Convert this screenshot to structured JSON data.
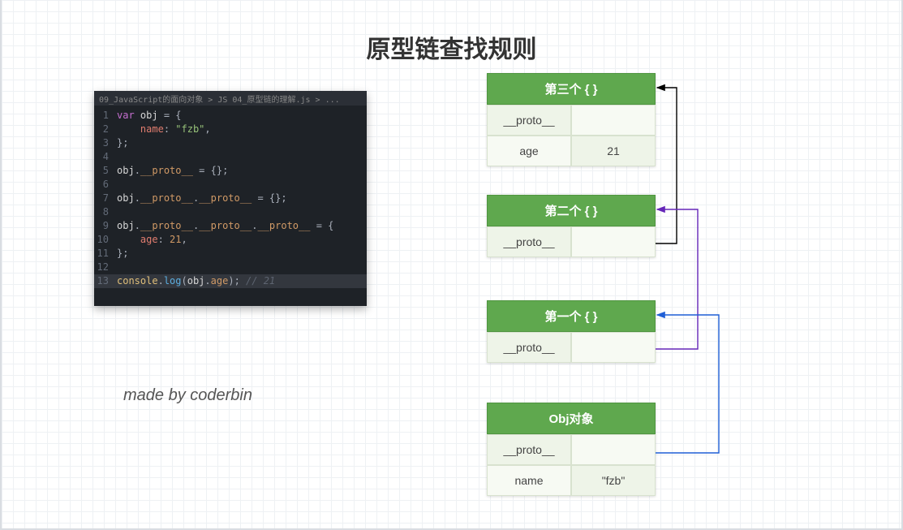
{
  "title": "原型链查找规则",
  "credit": "made by coderbin",
  "editor": {
    "tab": "09_JavaScript的面向对象 > JS  04_原型链的理解.js > ...",
    "lines": [
      {
        "n": 1,
        "segs": [
          [
            "kw",
            "var"
          ],
          [
            "punc",
            " "
          ],
          [
            "ident",
            "obj"
          ],
          [
            "punc",
            " = {"
          ]
        ]
      },
      {
        "n": 2,
        "segs": [
          [
            "punc",
            "    "
          ],
          [
            "prop",
            "name"
          ],
          [
            "punc",
            ": "
          ],
          [
            "str",
            "\"fzb\""
          ],
          [
            "punc",
            ","
          ]
        ]
      },
      {
        "n": 3,
        "segs": [
          [
            "punc",
            "};"
          ]
        ]
      },
      {
        "n": 4,
        "segs": []
      },
      {
        "n": 5,
        "segs": [
          [
            "ident",
            "obj"
          ],
          [
            "punc",
            "."
          ],
          [
            "prop2",
            "__proto__"
          ],
          [
            "punc",
            " = {};"
          ]
        ]
      },
      {
        "n": 6,
        "segs": []
      },
      {
        "n": 7,
        "segs": [
          [
            "ident",
            "obj"
          ],
          [
            "punc",
            "."
          ],
          [
            "prop2",
            "__proto__"
          ],
          [
            "punc",
            "."
          ],
          [
            "prop2",
            "__proto__"
          ],
          [
            "punc",
            " = {};"
          ]
        ]
      },
      {
        "n": 8,
        "segs": []
      },
      {
        "n": 9,
        "segs": [
          [
            "ident",
            "obj"
          ],
          [
            "punc",
            "."
          ],
          [
            "prop2",
            "__proto__"
          ],
          [
            "punc",
            "."
          ],
          [
            "prop2",
            "__proto__"
          ],
          [
            "punc",
            "."
          ],
          [
            "prop2",
            "__proto__"
          ],
          [
            "punc",
            " = {"
          ]
        ]
      },
      {
        "n": 10,
        "segs": [
          [
            "punc",
            "    "
          ],
          [
            "prop",
            "age"
          ],
          [
            "punc",
            ": "
          ],
          [
            "num",
            "21"
          ],
          [
            "punc",
            ","
          ]
        ]
      },
      {
        "n": 11,
        "segs": [
          [
            "punc",
            "};"
          ]
        ]
      },
      {
        "n": 12,
        "segs": []
      },
      {
        "n": 13,
        "hl": true,
        "segs": [
          [
            "obj",
            "console"
          ],
          [
            "punc",
            "."
          ],
          [
            "fn",
            "log"
          ],
          [
            "punc",
            "("
          ],
          [
            "ident",
            "obj"
          ],
          [
            "punc",
            "."
          ],
          [
            "prop2",
            "age"
          ],
          [
            "punc",
            ");"
          ],
          [
            "cmt",
            " // 21"
          ]
        ]
      }
    ]
  },
  "boxes": {
    "b3": {
      "title": "第三个 { }",
      "rows": [
        {
          "k": "__proto__",
          "v": ""
        },
        {
          "k": "age",
          "v": "21"
        }
      ]
    },
    "b2": {
      "title": "第二个 { }",
      "rows": [
        {
          "k": "__proto__",
          "v": ""
        }
      ]
    },
    "b1": {
      "title": "第一个 { }",
      "rows": [
        {
          "k": "__proto__",
          "v": ""
        }
      ]
    },
    "bObj": {
      "title": "Obj对象",
      "rows": [
        {
          "k": "__proto__",
          "v": ""
        },
        {
          "k": "name",
          "v": "\"fzb\""
        }
      ]
    }
  }
}
